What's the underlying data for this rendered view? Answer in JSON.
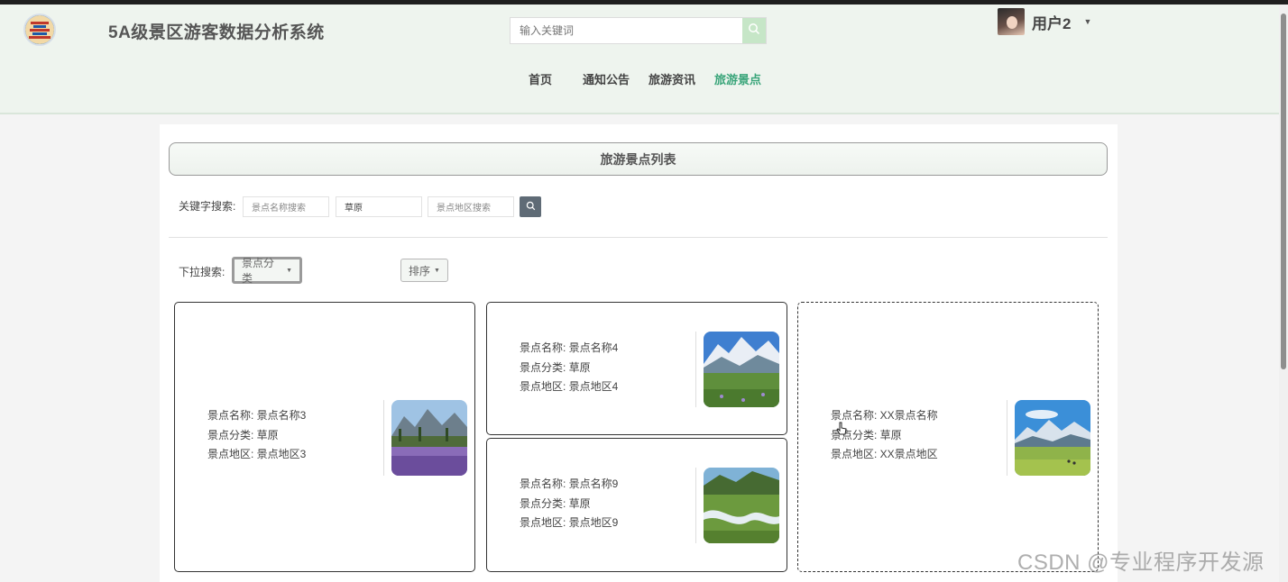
{
  "header": {
    "app_title": "5A级景区游客数据分析系统",
    "search_placeholder": "输入关键词",
    "user_name": "用户2",
    "nav": [
      "首页",
      "通知公告",
      "旅游资讯",
      "旅游景点"
    ],
    "active_nav": "旅游景点",
    "accent_color": "#3aa57a"
  },
  "main": {
    "list_title": "旅游景点列表",
    "keyword_label": "关键字搜索:",
    "keyword_inputs": [
      {
        "placeholder": "景点名称搜索",
        "value": ""
      },
      {
        "placeholder": "",
        "value": "草原"
      },
      {
        "placeholder": "景点地区搜索",
        "value": ""
      }
    ],
    "dropdown_label": "下拉搜索:",
    "category_dropdown": "景点分类",
    "sort_dropdown": "排序",
    "cards": [
      {
        "name": "景点名称: 景点名称3",
        "category": "景点分类: 草原",
        "region": "景点地区: 景点地区3",
        "image": "lavender-field-mountains"
      },
      {
        "name": "景点名称: 景点名称4",
        "category": "景点分类: 草原",
        "region": "景点地区: 景点地区4",
        "image": "snow-mountain-meadow"
      },
      {
        "name": "景点名称: 景点名称9",
        "category": "景点分类: 草原",
        "region": "景点地区: 景点地区9",
        "image": "winding-river-valley"
      },
      {
        "name": "景点名称: XX景点名称",
        "category": "景点分类: 草原",
        "region": "景点地区: XX景点地区",
        "image": "grassland-snow-peaks"
      }
    ]
  },
  "watermark": "CSDN @专业程序开发源"
}
